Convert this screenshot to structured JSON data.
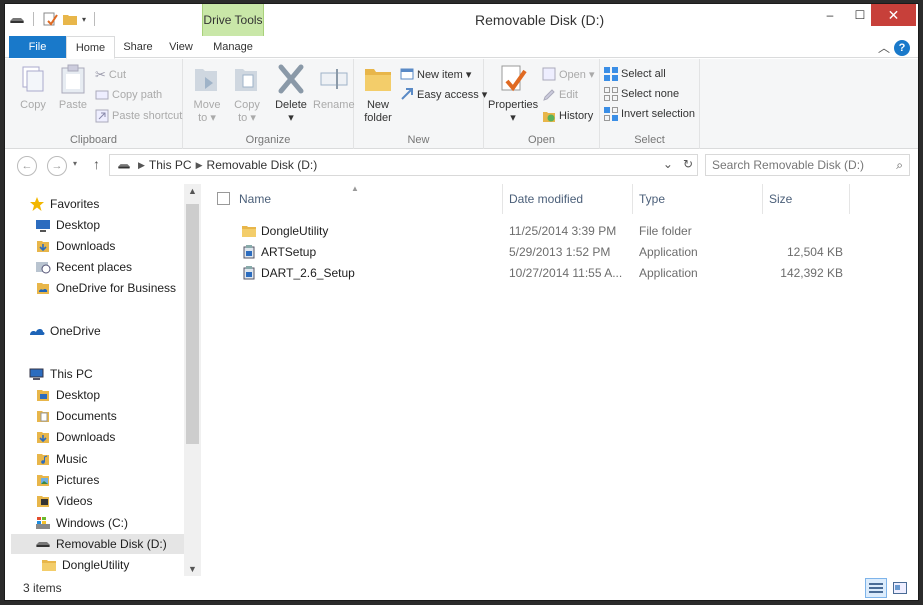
{
  "window": {
    "title": "Removable Disk (D:)",
    "context_tab_group": "Drive Tools",
    "controls": {
      "minimize": "–",
      "maximize": "☐",
      "close": "✕"
    }
  },
  "ribbon": {
    "tabs": [
      "File",
      "Home",
      "Share",
      "View",
      "Manage"
    ],
    "help": "?",
    "clipboard": {
      "label": "Clipboard",
      "copy": "Copy",
      "paste": "Paste",
      "cut": "Cut",
      "copy_path": "Copy path",
      "paste_shortcut": "Paste shortcut"
    },
    "organize": {
      "label": "Organize",
      "move_to_1": "Move",
      "move_to_2": "to ▾",
      "copy_to_1": "Copy",
      "copy_to_2": "to ▾",
      "delete": "Delete",
      "delete_arrow": "▾",
      "rename": "Rename"
    },
    "new": {
      "label": "New",
      "new_folder_1": "New",
      "new_folder_2": "folder",
      "new_item": "New item ▾",
      "easy_access": "Easy access ▾"
    },
    "open": {
      "label": "Open",
      "properties": "Properties",
      "properties_arrow": "▾",
      "open": "Open ▾",
      "edit": "Edit",
      "history": "History"
    },
    "select": {
      "label": "Select",
      "select_all": "Select all",
      "select_none": "Select none",
      "invert_selection": "Invert selection"
    }
  },
  "address": {
    "back": "←",
    "forward": "→",
    "up": "↑",
    "crumbs": [
      "This PC",
      "Removable Disk (D:)"
    ],
    "search_placeholder": "Search Removable Disk (D:)"
  },
  "nav": {
    "items": [
      {
        "label": "Favorites",
        "indent": 0,
        "icon": "star-icon"
      },
      {
        "label": "Desktop",
        "indent": 1,
        "icon": "desktop-icon"
      },
      {
        "label": "Downloads",
        "indent": 1,
        "icon": "downloads-icon"
      },
      {
        "label": "Recent places",
        "indent": 1,
        "icon": "recent-places-icon"
      },
      {
        "label": "OneDrive for Business",
        "indent": 1,
        "icon": "onedrive-business-icon"
      },
      {
        "label": "OneDrive",
        "indent": 0,
        "icon": "onedrive-icon"
      },
      {
        "label": "This PC",
        "indent": 0,
        "icon": "this-pc-icon"
      },
      {
        "label": "Desktop",
        "indent": 1,
        "icon": "desktop-folder-icon"
      },
      {
        "label": "Documents",
        "indent": 1,
        "icon": "documents-icon"
      },
      {
        "label": "Downloads",
        "indent": 1,
        "icon": "downloads-icon"
      },
      {
        "label": "Music",
        "indent": 1,
        "icon": "music-icon"
      },
      {
        "label": "Pictures",
        "indent": 1,
        "icon": "pictures-icon"
      },
      {
        "label": "Videos",
        "indent": 1,
        "icon": "videos-icon"
      },
      {
        "label": "Windows (C:)",
        "indent": 1,
        "icon": "windows-drive-icon"
      },
      {
        "label": "Removable Disk (D:)",
        "indent": 1,
        "icon": "removable-disk-icon",
        "selected": true
      },
      {
        "label": "DongleUtility",
        "indent": 2,
        "icon": "folder-icon"
      }
    ]
  },
  "files": {
    "columns": [
      "Name",
      "Date modified",
      "Type",
      "Size"
    ],
    "rows": [
      {
        "name": "DongleUtility",
        "date": "11/25/2014 3:39 PM",
        "type": "File folder",
        "size": "",
        "icon": "folder-icon"
      },
      {
        "name": "ARTSetup",
        "date": "5/29/2013 1:52 PM",
        "type": "Application",
        "size": "12,504 KB",
        "icon": "installer-icon"
      },
      {
        "name": "DART_2.6_Setup",
        "date": "10/27/2014 11:55 A...",
        "type": "Application",
        "size": "142,392 KB",
        "icon": "installer-icon"
      }
    ]
  },
  "status": {
    "count": "3 items"
  },
  "colors": {
    "accent": "#1979ca",
    "drive_tools": "#c9e7a8",
    "close": "#c7403a",
    "folder": "#e8b64a"
  }
}
